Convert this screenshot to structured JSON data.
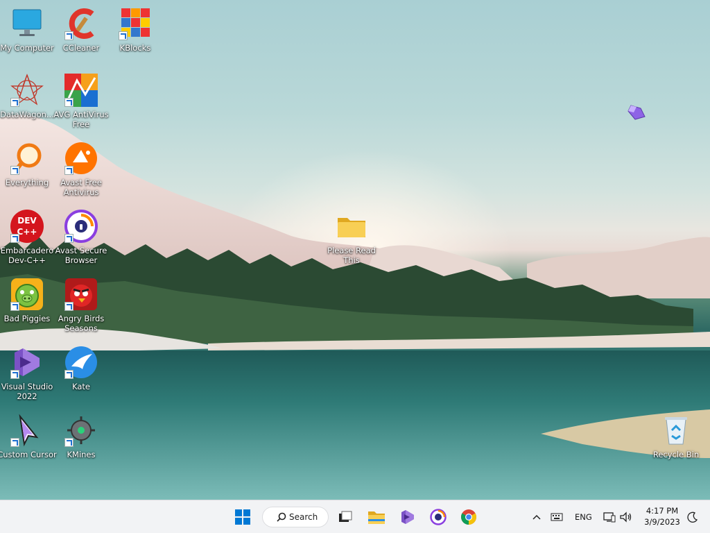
{
  "desktop": {
    "icons": [
      {
        "label": "My Computer"
      },
      {
        "label": "CCleaner"
      },
      {
        "label": "KBlocks"
      },
      {
        "label": "DataWagon..."
      },
      {
        "label": "AVG AntiVirus Free"
      },
      {
        "label": "Everything"
      },
      {
        "label": "Avast Free Antivirus"
      },
      {
        "label": "Embarcadero Dev-C++"
      },
      {
        "label": "Avast Secure Browser"
      },
      {
        "label": "Bad Piggies"
      },
      {
        "label": "Angry Birds Seasons"
      },
      {
        "label": "Visual Studio 2022"
      },
      {
        "label": "Kate"
      },
      {
        "label": "Custom Cursor"
      },
      {
        "label": "KMines"
      },
      {
        "label": "Please Read This"
      },
      {
        "label": "Recycle Bin"
      }
    ],
    "devcpp_badge": "DEV C++"
  },
  "taskbar": {
    "search_label": "Search",
    "tray": {
      "language": "ENG",
      "time": "4:17 PM",
      "date": "3/9/2023"
    }
  },
  "colors": {
    "accent": "#0067c0",
    "folder": "#f5c542",
    "taskbar": "#f2f3f5"
  }
}
